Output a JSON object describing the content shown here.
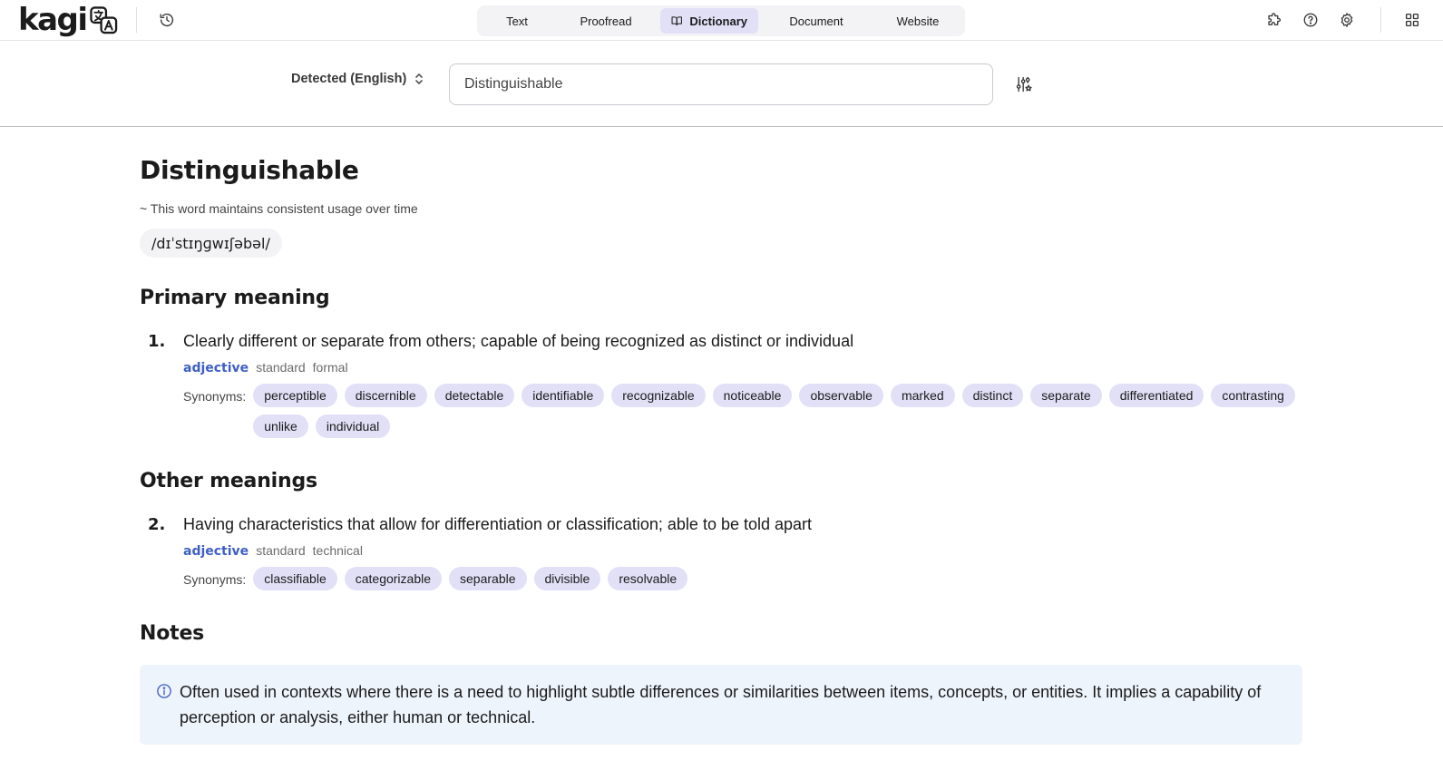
{
  "app": {
    "logo_text": "kagi"
  },
  "modes": [
    {
      "label": "Text",
      "active": false
    },
    {
      "label": "Proofread",
      "active": false
    },
    {
      "label": "Dictionary",
      "active": true
    },
    {
      "label": "Document",
      "active": false
    },
    {
      "label": "Website",
      "active": false
    }
  ],
  "search": {
    "language": "Detected (English)",
    "query": "Distinguishable"
  },
  "entry": {
    "word": "Distinguishable",
    "usage_note": "~ This word maintains consistent usage over time",
    "pronunciation": "/dɪˈstɪŋɡwɪʃəbəl/"
  },
  "sections": {
    "primary_heading": "Primary meaning",
    "other_heading": "Other meanings",
    "notes_heading": "Notes",
    "synonyms_label": "Synonyms:"
  },
  "meanings": [
    {
      "number": "1.",
      "definition": "Clearly different or separate from others; capable of being recognized as distinct or individual",
      "pos": "adjective",
      "tags": [
        "standard",
        "formal"
      ],
      "synonyms": [
        "perceptible",
        "discernible",
        "detectable",
        "identifiable",
        "recognizable",
        "noticeable",
        "observable",
        "marked",
        "distinct",
        "separate",
        "differentiated",
        "contrasting",
        "unlike",
        "individual"
      ]
    },
    {
      "number": "2.",
      "definition": "Having characteristics that allow for differentiation or classification; able to be told apart",
      "pos": "adjective",
      "tags": [
        "standard",
        "technical"
      ],
      "synonyms": [
        "classifiable",
        "categorizable",
        "separable",
        "divisible",
        "resolvable"
      ]
    }
  ],
  "notes": {
    "text": "Often used in contexts where there is a need to highlight subtle differences or similarities between items, concepts, or entities. It implies a capability of perception or analysis, either human or technical."
  },
  "colors": {
    "accent": "#3e5fc4",
    "chip_bg": "#e2e0f7",
    "note_bg": "#eef4fc"
  }
}
